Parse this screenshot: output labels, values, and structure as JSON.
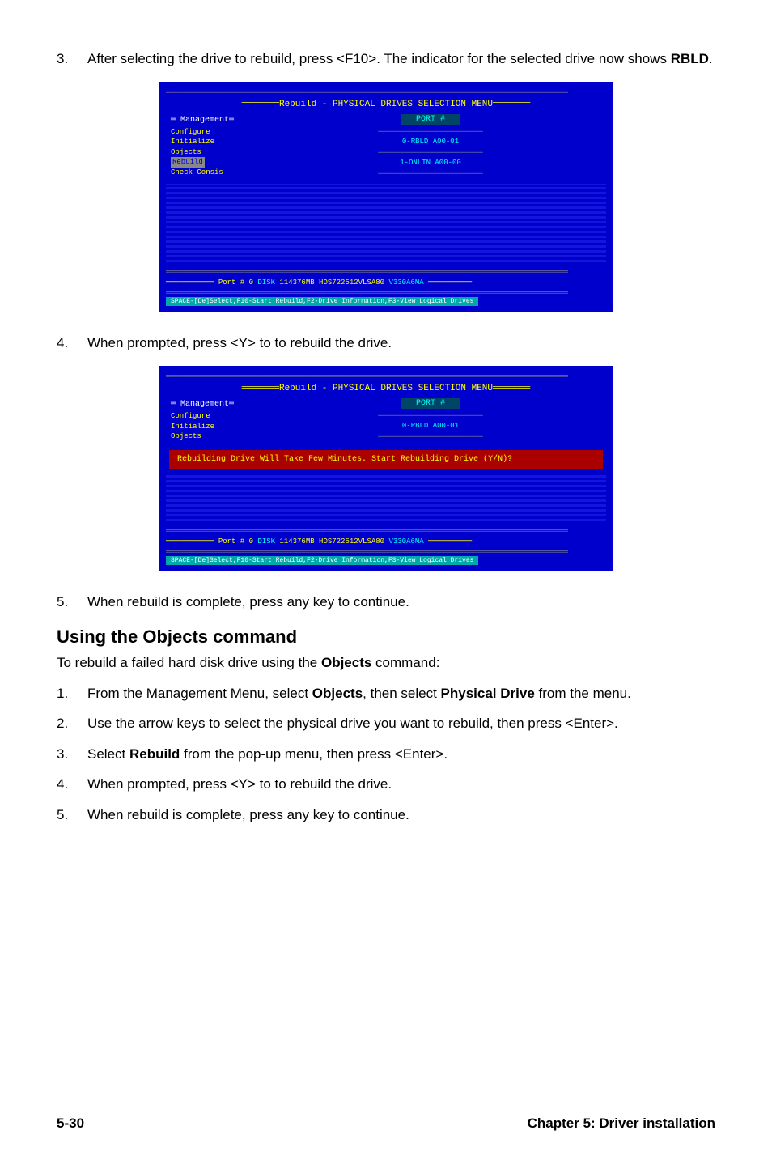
{
  "steps_top": {
    "step3": {
      "num": "3.",
      "text_pre": "After selecting the drive to rebuild, press <F10>. The indicator for the selected drive now shows ",
      "bold": "RBLD",
      "text_post": "."
    },
    "step4": {
      "num": "4.",
      "text": "When prompted, press <Y> to to rebuild the drive."
    },
    "step5": {
      "num": "5.",
      "text": "When rebuild is complete, press any key to continue."
    }
  },
  "screenshot1": {
    "title": "Rebuild - PHYSICAL DRIVES SELECTION MENU",
    "menu_title": "Management",
    "menu_items": [
      "Configure",
      "Initialize",
      "Objects",
      "Rebuild",
      "Check Consis"
    ],
    "port_header": "PORT #",
    "drive1": "0-RBLD  A00-01",
    "drive2": "1-ONLIN A00-00",
    "port_info_left": "Port # 0 ",
    "port_disk": "DISK",
    "port_mid": "  114376MB  HDS722512VLSA80  ",
    "port_ver": "V330A6MA",
    "help": "SPACE-[De]Select,F10-Start Rebuild,F2-Drive Information,F3-View Logical Drives"
  },
  "screenshot2": {
    "title": "Rebuild - PHYSICAL DRIVES SELECTION MENU",
    "menu_title": "Management",
    "menu_items": [
      "Configure",
      "Initialize",
      "Objects"
    ],
    "port_header": "PORT #",
    "drive1": "0-RBLD  A00-01",
    "rebuild_msg": "Rebuilding Drive Will Take Few Minutes. Start Rebuilding Drive (Y/N)?",
    "port_info_left": "Port # 0 ",
    "port_disk": "DISK",
    "port_mid": "  114376MB  HDS722512VLSA80  ",
    "port_ver": "V330A6MA",
    "help": "SPACE-[De]Select,F10-Start Rebuild,F2-Drive Information,F3-View Logical Drives"
  },
  "section": {
    "heading": "Using the Objects command",
    "intro_pre": "To rebuild a failed hard disk drive using the ",
    "intro_bold": "Objects",
    "intro_post": " command:"
  },
  "steps_bottom": {
    "step1": {
      "num": "1.",
      "pre": "From the Management Menu, select ",
      "b1": "Objects",
      "mid": ", then select ",
      "b2": "Physical Drive",
      "post": " from the menu."
    },
    "step2": {
      "num": "2.",
      "text": "Use the arrow keys to select the physical drive you want to rebuild, then press <Enter>."
    },
    "step3": {
      "num": "3.",
      "pre": "Select ",
      "b1": "Rebuild",
      "post": " from the pop-up menu, then press <Enter>."
    },
    "step4": {
      "num": "4.",
      "text": "When prompted, press <Y> to to rebuild the drive."
    },
    "step5": {
      "num": "5.",
      "text": "When rebuild is complete, press any key to continue."
    }
  },
  "footer": {
    "left": "5-30",
    "right": "Chapter 5: Driver installation"
  }
}
